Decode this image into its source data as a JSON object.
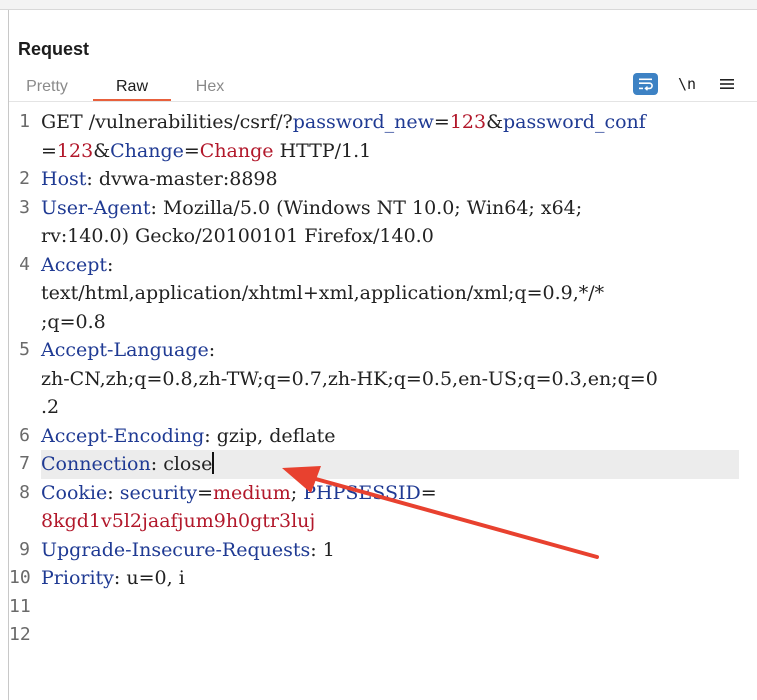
{
  "panel": {
    "title": "Request"
  },
  "tabs": [
    {
      "label": "Pretty",
      "active": false
    },
    {
      "label": "Raw",
      "active": true
    },
    {
      "label": "Hex",
      "active": false
    }
  ],
  "toolbar": {
    "wrap_icon": "wrap-lines-icon",
    "newline_label": "\\n",
    "menu_icon": "hamburger-menu-icon"
  },
  "gutter": {
    "line_numbers": [
      "1",
      "2",
      "3",
      "4",
      "5",
      "6",
      "7",
      "8",
      "9",
      "10",
      "11",
      "12"
    ]
  },
  "request": {
    "l1": {
      "method": "GET",
      "path": "/vulnerabilities/csrf/?",
      "p1": "password_new",
      "eq1": "=",
      "v1": "123",
      "amp1": "&",
      "p2": "password_conf",
      "eq2": "=",
      "v2": "123",
      "amp2": "&",
      "p3": "Change",
      "eq3": "=",
      "v3": "Change",
      "proto": " HTTP/1.1"
    },
    "l2": {
      "key": "Host",
      "sep": ": ",
      "value": "dvwa-master:8898"
    },
    "l3": {
      "key": "User-Agent",
      "sep": ": ",
      "value_a": "Mozilla/5.0 (Windows NT 10.0; Win64; x64;",
      "value_b": "rv:140.0) Gecko/20100101 Firefox/140.0"
    },
    "l4": {
      "key": "Accept",
      "sep": ":",
      "value_a": "text/html,application/xhtml+xml,application/xml;q=0.9,*/*",
      "value_b": ";q=0.8"
    },
    "l5": {
      "key": "Accept-Language",
      "sep": ":",
      "value_a": "zh-CN,zh;q=0.8,zh-TW;q=0.7,zh-HK;q=0.5,en-US;q=0.3,en;q=0",
      "value_b": ".2"
    },
    "l6": {
      "key": "Accept-Encoding",
      "sep": ": ",
      "value": "gzip, deflate"
    },
    "l7": {
      "key": "Connection",
      "sep": ": ",
      "value": "close"
    },
    "l8": {
      "key": "Cookie",
      "sep": ": ",
      "c1": "security",
      "eq1": "=",
      "v1": "medium",
      "semi": "; ",
      "c2": "PHPSESSID",
      "eq2": "=",
      "v2": "8kgd1v5l2jaafjum9h0gtr3luj"
    },
    "l9": {
      "key": "Upgrade-Insecure-Requests",
      "sep": ": ",
      "value": "1"
    },
    "l10": {
      "key": "Priority",
      "sep": ": ",
      "value": "u=0, i"
    }
  },
  "colors": {
    "accent_tab": "#e8603c",
    "header_key": "#1f3a93",
    "param_value": "#b2182b",
    "annotation_arrow": "#e8412f",
    "wrap_button": "#3d82c4"
  }
}
